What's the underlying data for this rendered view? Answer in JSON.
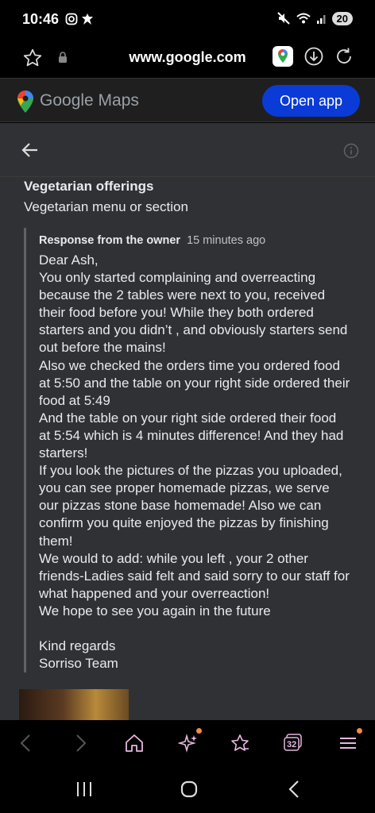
{
  "status_bar": {
    "time": "10:46",
    "battery": "20"
  },
  "browser": {
    "url": "www.google.com"
  },
  "maps_header": {
    "logo": "Google Maps",
    "open_app_label": "Open app"
  },
  "review": {
    "section_title": "Vegetarian offerings",
    "section_value": "Vegetarian menu or section",
    "owner_label": "Response from the owner",
    "owner_time": "15 minutes ago",
    "owner_reply": "Dear Ash,\nYou only started complaining and overreacting because the 2 tables were next to you, received their food before you! While they both ordered starters and you didn’t , and obviously starters send out before the mains!\nAlso we checked the orders time you ordered food at 5:50 and the table on your right side ordered their food at 5:49\nAnd the table on your right side ordered their food at 5:54 which is 4 minutes difference! And they had starters!\nIf you look the pictures of the pizzas you uploaded, you can see proper homemade pizzas, we serve our pizzas stone base homemade! Also we can confirm you quite enjoyed the pizzas by finishing them!\nWe would to add: while you left , your 2 other friends-Ladies said felt and said sorry to our staff for what happened and your overreaction!\nWe hope to see you again in the future\n\nKind regards\nSorriso Team"
  },
  "toolbar": {
    "tabs_count": "32"
  },
  "colors": {
    "open_app_bg": "#0b3bd6",
    "notification_dot": "#f28a4b",
    "content_bg": "#303134"
  }
}
